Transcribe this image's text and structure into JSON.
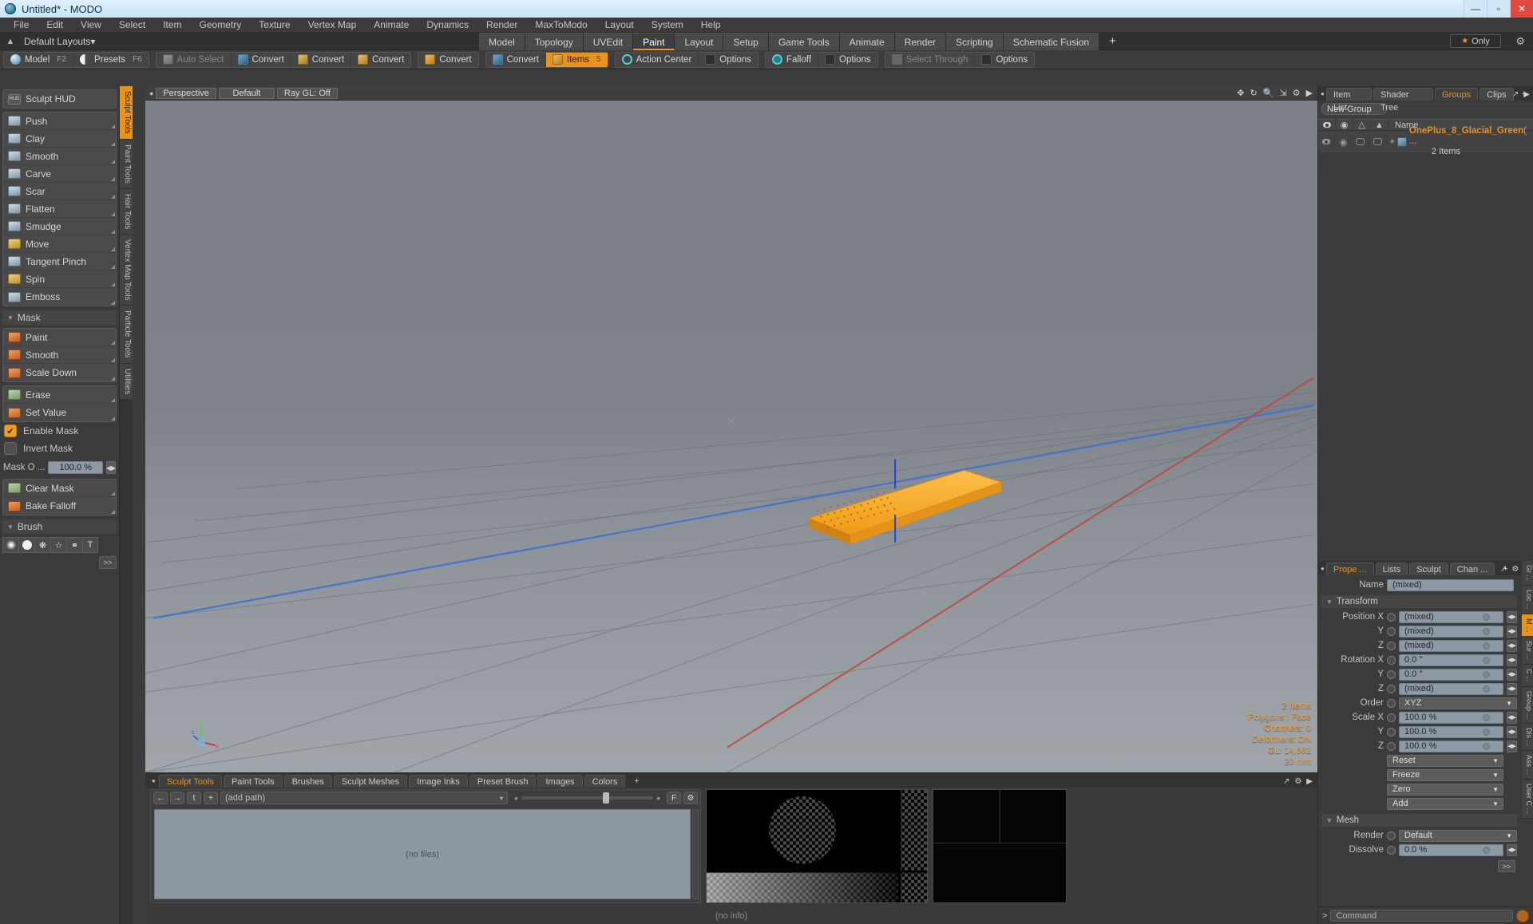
{
  "window": {
    "title": "Untitled* - MODO",
    "buttons": {
      "minimize": "—",
      "maximize": "▫",
      "close": "✕"
    }
  },
  "menubar": [
    "File",
    "Edit",
    "View",
    "Select",
    "Item",
    "Geometry",
    "Texture",
    "Vertex Map",
    "Animate",
    "Dynamics",
    "Render",
    "MaxToModo",
    "Layout",
    "System",
    "Help"
  ],
  "layoutbar": {
    "layout_label": "Default Layouts",
    "caret": "▾",
    "only_label": "Only",
    "star": "★",
    "gear": "gear-icon"
  },
  "mode_tabs": [
    {
      "label": "Model",
      "active": false
    },
    {
      "label": "Topology",
      "active": false
    },
    {
      "label": "UVEdit",
      "active": false
    },
    {
      "label": "Paint",
      "active": true
    },
    {
      "label": "Layout",
      "active": false
    },
    {
      "label": "Setup",
      "active": false
    },
    {
      "label": "Game Tools",
      "active": false
    },
    {
      "label": "Animate",
      "active": false
    },
    {
      "label": "Render",
      "active": false
    },
    {
      "label": "Scripting",
      "active": false
    },
    {
      "label": "Schematic Fusion",
      "active": false
    },
    {
      "label": "+",
      "active": false
    }
  ],
  "toolbar": {
    "groups": [
      {
        "items": [
          {
            "label": "Model",
            "key": "F2",
            "icon": "sphere",
            "state": "normal"
          },
          {
            "label": "Presets",
            "key": "F6",
            "icon": "half",
            "state": "normal"
          }
        ]
      },
      {
        "items": [
          {
            "label": "Auto Select",
            "key": "",
            "icon": "cube",
            "state": "dim"
          },
          {
            "label": "Convert",
            "key": "",
            "icon": "cube-b",
            "state": "normal"
          },
          {
            "label": "Convert",
            "key": "",
            "icon": "cube-y",
            "state": "normal"
          },
          {
            "label": "Convert",
            "key": "",
            "icon": "cube-o",
            "state": "normal"
          }
        ]
      },
      {
        "items": [
          {
            "label": "Convert",
            "key": "",
            "icon": "cube-or",
            "state": "normal"
          }
        ]
      },
      {
        "items": [
          {
            "label": "Convert",
            "key": "",
            "icon": "cube-b",
            "state": "normal"
          },
          {
            "label": "Items",
            "key": "5",
            "icon": "cube-or",
            "state": "active"
          }
        ]
      },
      {
        "items": [
          {
            "label": "Action Center",
            "key": "",
            "icon": "target",
            "state": "normal"
          },
          {
            "label": "Options",
            "key": "",
            "icon": "chk",
            "state": "normal"
          }
        ]
      },
      {
        "items": [
          {
            "label": "Falloff",
            "key": "",
            "icon": "target2",
            "state": "normal"
          },
          {
            "label": "Options",
            "key": "",
            "icon": "chk",
            "state": "normal"
          }
        ]
      },
      {
        "items": [
          {
            "label": "Select Through",
            "key": "",
            "icon": "thru",
            "state": "dim"
          },
          {
            "label": "Options",
            "key": "",
            "icon": "chk",
            "state": "normal"
          }
        ]
      }
    ]
  },
  "left_panel": {
    "hud_button": "Sculpt HUD",
    "hud_icon_text": "HUD",
    "sculpt_tools": [
      {
        "label": "Push",
        "icon": "blue"
      },
      {
        "label": "Clay",
        "icon": "blue"
      },
      {
        "label": "Smooth",
        "icon": "blue"
      },
      {
        "label": "Carve",
        "icon": "blue"
      },
      {
        "label": "Scar",
        "icon": "blue"
      },
      {
        "label": "Flatten",
        "icon": "blue"
      },
      {
        "label": "Smudge",
        "icon": "blue"
      },
      {
        "label": "Move",
        "icon": "y"
      },
      {
        "label": "Tangent Pinch",
        "icon": "blue"
      },
      {
        "label": "Spin",
        "icon": "y"
      },
      {
        "label": "Emboss",
        "icon": "blue"
      }
    ],
    "mask_section": "Mask",
    "mask_tools_a": [
      {
        "label": "Paint",
        "icon": "o"
      },
      {
        "label": "Smooth",
        "icon": "o"
      },
      {
        "label": "Scale Down",
        "icon": "o"
      }
    ],
    "mask_tools_b": [
      {
        "label": "Erase",
        "icon": "g"
      },
      {
        "label": "Set Value",
        "icon": "o"
      }
    ],
    "enable_mask": {
      "label": "Enable Mask",
      "checked": true,
      "check": "✔"
    },
    "invert_mask": {
      "label": "Invert Mask",
      "checked": false
    },
    "mask_opacity": {
      "label": "Mask O ...",
      "value": "100.0 %"
    },
    "mask_tools_c": [
      {
        "label": "Clear Mask",
        "icon": "g"
      },
      {
        "label": "Bake Falloff",
        "icon": "o"
      }
    ],
    "brush_section": "Brush",
    "brush_icons": [
      "soft-brush-icon",
      "hard-brush-icon",
      "noise-brush-icon",
      "star-brush-icon",
      "curve-brush-icon",
      "text-brush-icon"
    ],
    "brush_text_glyph": "T",
    "more_button": ">>"
  },
  "vertical_tabs": [
    {
      "label": "Sculpt Tools",
      "active": true
    },
    {
      "label": "Paint Tools",
      "active": false
    },
    {
      "label": "Hair Tools",
      "active": false
    },
    {
      "label": "Vertex Map Tools",
      "active": false
    },
    {
      "label": "Particle Tools",
      "active": false
    },
    {
      "label": "Utilities",
      "active": false
    }
  ],
  "viewport": {
    "chips": [
      "Perspective",
      "Default",
      "Ray GL: Off"
    ],
    "icons": [
      "pan-icon",
      "rotate-icon",
      "zoom-icon",
      "fit-icon",
      "gear-icon",
      "chevron-right-icon"
    ],
    "hud": {
      "items": "2 Items",
      "polygons": "Polygons : Face",
      "channels": "Channels: 0",
      "deformers": "Deformers: ON",
      "gl": "GL: 14,662",
      "scale": "20 mm"
    },
    "axis_labels": [
      "y",
      "z",
      "x"
    ]
  },
  "bottom_panel": {
    "tabs": [
      {
        "label": "Sculpt Tools",
        "active": true
      },
      {
        "label": "Paint Tools",
        "active": false
      },
      {
        "label": "Brushes",
        "active": false
      },
      {
        "label": "Sculpt Meshes",
        "active": false
      },
      {
        "label": "Image Inks",
        "active": false
      },
      {
        "label": "Preset Brush",
        "active": false
      },
      {
        "label": "Images",
        "active": false
      },
      {
        "label": "Colors",
        "active": false
      },
      {
        "label": "+",
        "active": false
      }
    ],
    "nav_buttons": [
      "←",
      "→",
      "t",
      "+"
    ],
    "path_placeholder": "(add path)",
    "path_caret": "▾",
    "f_button": "F",
    "gear_button": "gear-icon",
    "files_empty": "(no files)",
    "info_empty": "(no info)",
    "tab_icons": [
      "expand-icon",
      "gear-icon",
      "chevron-right-icon"
    ]
  },
  "right_panel": {
    "top_tabs": [
      {
        "label": "Item List",
        "active": false
      },
      {
        "label": "Shader Tree",
        "active": false
      },
      {
        "label": "Groups",
        "active": true
      },
      {
        "label": "Clips",
        "active": false
      },
      {
        "label": "+",
        "active": false
      }
    ],
    "top_tab_icons": [
      "expand-icon",
      "chevron-right-icon"
    ],
    "new_group_button": "New Group",
    "list_header_name": "Name",
    "list_header_icons": [
      "eye-icon",
      "render-icon",
      "shade-icon",
      "wire-icon"
    ],
    "group_item": {
      "name": "OnePlus_8_Glacial_Green",
      "suffix": "( ...",
      "sub": "2 Items",
      "expand": "+"
    },
    "prop_tabs": [
      {
        "label": "Prope ...",
        "active": true
      },
      {
        "label": "Lists",
        "active": false
      },
      {
        "label": "Sculpt",
        "active": false
      },
      {
        "label": "Chan ...",
        "active": false
      },
      {
        "label": "+",
        "active": false
      }
    ],
    "prop_tab_icons": [
      "expand-icon",
      "gear-icon",
      "chevron-right-icon"
    ],
    "name_label": "Name",
    "name_value": "(mixed)",
    "transform_section": "Transform",
    "transform_rows": [
      {
        "label": "Position X",
        "value": "(mixed)",
        "type": "num"
      },
      {
        "label": "Y",
        "value": "(mixed)",
        "type": "num"
      },
      {
        "label": "Z",
        "value": "(mixed)",
        "type": "num"
      },
      {
        "label": "Rotation X",
        "value": "0.0 °",
        "type": "num"
      },
      {
        "label": "Y",
        "value": "0.0 °",
        "type": "num"
      },
      {
        "label": "Z",
        "value": "(mixed)",
        "type": "num"
      },
      {
        "label": "Order",
        "value": "XYZ",
        "type": "select"
      },
      {
        "label": "Scale X",
        "value": "100.0 %",
        "type": "num"
      },
      {
        "label": "Y",
        "value": "100.0 %",
        "type": "num"
      },
      {
        "label": "Z",
        "value": "100.0 %",
        "type": "num"
      }
    ],
    "action_menus": [
      "Reset",
      "Freeze",
      "Zero",
      "Add"
    ],
    "mesh_section": "Mesh",
    "mesh_rows": [
      {
        "label": "Render",
        "value": "Default",
        "type": "select"
      },
      {
        "label": "Dissolve",
        "value": "0.0 %",
        "type": "num"
      }
    ],
    "more_button": ">>",
    "side_tabs": [
      {
        "label": "Gr ...",
        "active": false
      },
      {
        "label": "Loc ...",
        "active": false
      },
      {
        "label": "M ...",
        "active": true
      },
      {
        "label": "Sur ...",
        "active": false
      },
      {
        "label": "C ...",
        "active": false
      },
      {
        "label": "Group ...",
        "active": false
      },
      {
        "label": "Dis ...",
        "active": false
      },
      {
        "label": "Ass ...",
        "active": false
      },
      {
        "label": "User C ...",
        "active": false
      }
    ]
  },
  "command_bar": {
    "prefix": ">",
    "placeholder": "Command",
    "go_button": "go-icon"
  },
  "colors": {
    "accent": "#e8921f",
    "selection": "#f5a623",
    "panel": "#3b3b3b",
    "viewport_top": "#7e8489"
  }
}
